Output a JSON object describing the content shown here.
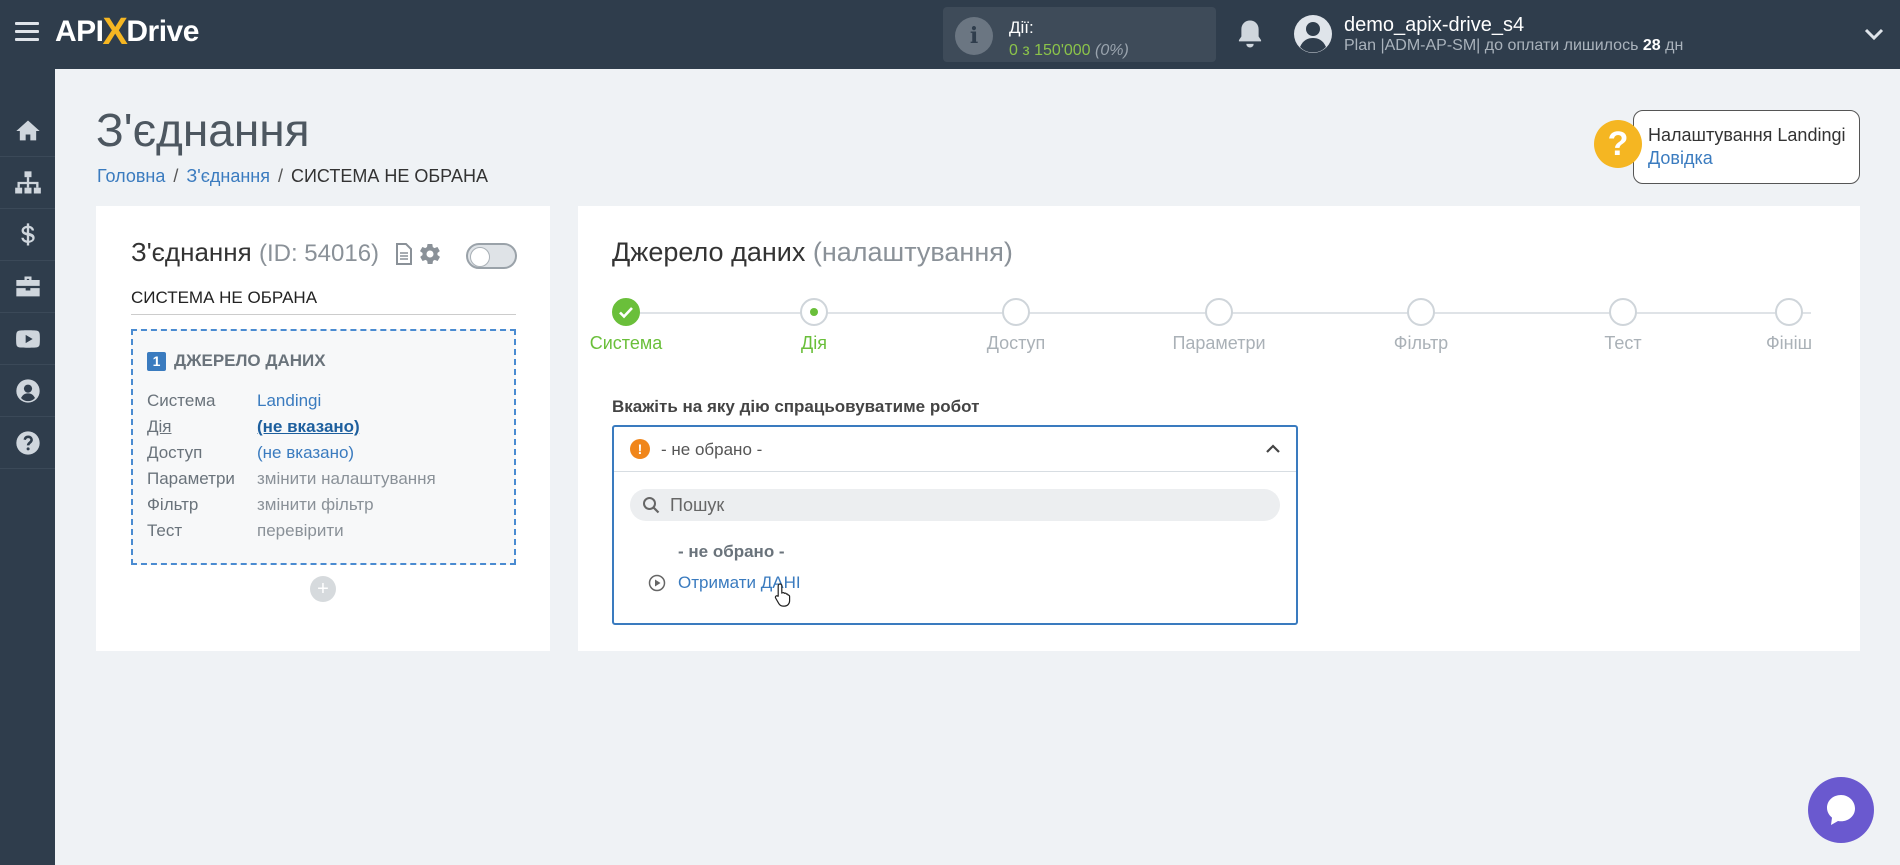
{
  "topbar": {
    "logo_part1": "API",
    "logo_x": "X",
    "logo_part2": "Drive",
    "actions_label": "Дії:",
    "actions_value": "0 з 150'000",
    "actions_percent": "(0%)",
    "user_name": "demo_apix-drive_s4",
    "plan_text": "Plan |ADM-AP-SM| до оплати лишилось",
    "plan_days": "28",
    "plan_days_unit": "дн"
  },
  "sidebar": {
    "items": [
      "home-icon",
      "sitemap-icon",
      "dollar-icon",
      "briefcase-icon",
      "youtube-icon",
      "user-icon",
      "help-icon"
    ]
  },
  "page": {
    "title": "З'єднання",
    "breadcrumb": [
      "Головна",
      "З'єднання",
      "СИСТЕМА НЕ ОБРАНА"
    ]
  },
  "help": {
    "title": "Налаштування Landingi",
    "link": "Довідка",
    "icon": "?"
  },
  "connection": {
    "title": "З'єднання",
    "id_text": "(ID: 54016)",
    "system_label": "СИСТЕМА НЕ ОБРАНА",
    "source": {
      "number": "1",
      "heading": "ДЖЕРЕЛО ДАНИХ",
      "rows": [
        {
          "key": "Система",
          "value": "Landingi"
        },
        {
          "key": "Дія",
          "value": "(не вказано)"
        },
        {
          "key": "Доступ",
          "value": "(не вказано)"
        },
        {
          "key": "Параметри",
          "value": "змінити налаштування"
        },
        {
          "key": "Фільтр",
          "value": "змінити фільтр"
        },
        {
          "key": "Тест",
          "value": "перевірити"
        }
      ]
    },
    "add_symbol": "+"
  },
  "datasource": {
    "title": "Джерело даних",
    "subtitle": "(налаштування)",
    "steps": [
      "Система",
      "Дія",
      "Доступ",
      "Параметри",
      "Фільтр",
      "Тест",
      "Фініш"
    ],
    "step_states": [
      "done",
      "active",
      "pending",
      "pending",
      "pending",
      "pending",
      "pending"
    ],
    "robot_label": "Вкажіть на яку дію спрацьовуватиме робот",
    "dropdown": {
      "selected": "- не обрано -",
      "warn_symbol": "!",
      "search_placeholder": "Пошук",
      "options": [
        "- не обрано -",
        "Отримати ДАНІ"
      ]
    }
  },
  "colors": {
    "topbar": "#2f3d4c",
    "accent": "#3a7bbf",
    "success": "#6abf3a",
    "warning": "#f0861b",
    "brand_yellow": "#f5b622",
    "chat": "#6a59cf"
  }
}
